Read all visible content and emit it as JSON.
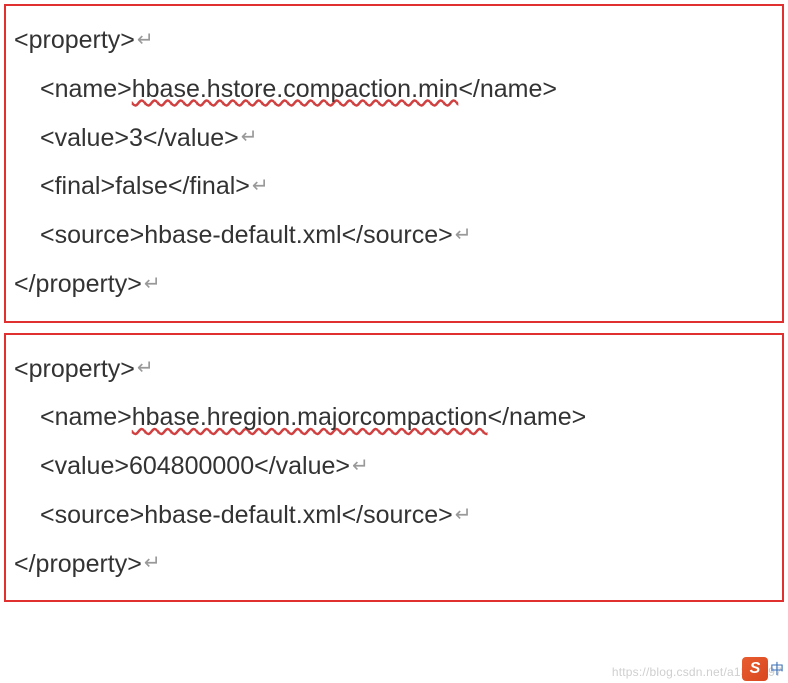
{
  "property1": {
    "open_tag": "<property>",
    "name_open": "<name>",
    "name_value": "hbase.hstore.compaction.min",
    "name_close": "</name>",
    "value_open": "<value>",
    "value_text": "3",
    "value_close": "</value>",
    "final_open": "<final>",
    "final_text": "false",
    "final_close": "</final>",
    "source_open": "<source>",
    "source_text": "hbase-default.xml",
    "source_close": "</source>",
    "close_tag": "</property>"
  },
  "property2": {
    "open_tag": "<property>",
    "name_open": "<name>",
    "name_value": "hbase.hregion.majorcompaction",
    "name_close": "</name>",
    "value_open": "<value>",
    "value_text": "604800000",
    "value_close": "</value>",
    "source_open": "<source>",
    "source_text": "hbase-default.xml",
    "source_close": "</source>",
    "close_tag": "</property>"
  },
  "glyphs": {
    "return": "↵"
  },
  "watermark": "https://blog.csdn.net/a1381397",
  "ime": "中"
}
